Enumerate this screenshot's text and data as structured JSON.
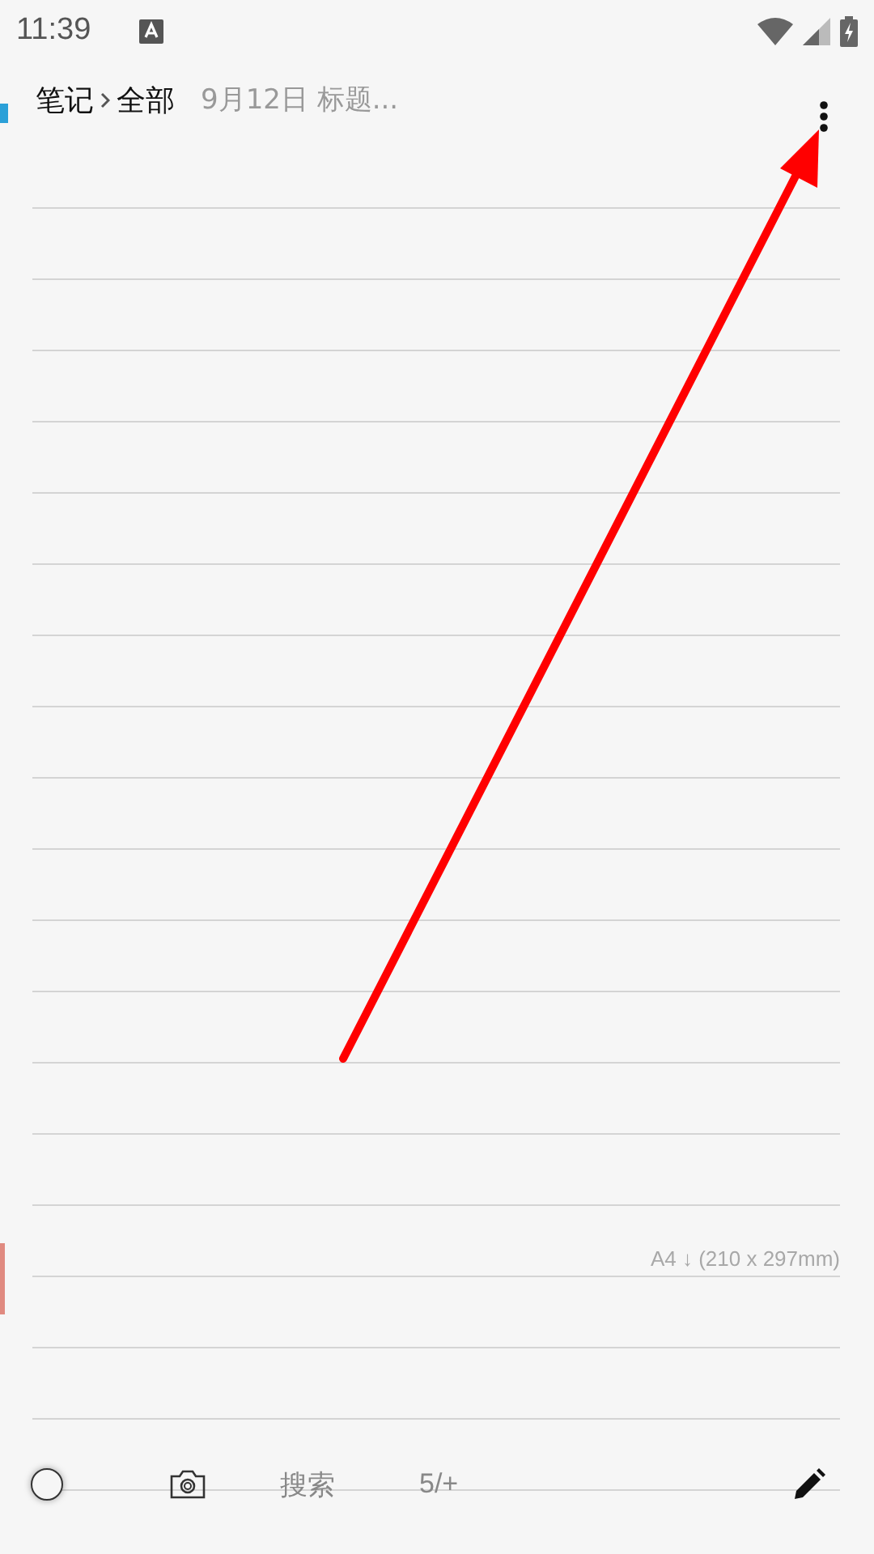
{
  "status_bar": {
    "time": "11:39"
  },
  "header": {
    "breadcrumb": [
      "笔记",
      "全部"
    ],
    "subtitle": "9月12日 标题..."
  },
  "page": {
    "size_label": "A4 ↓ (210 x 297mm)"
  },
  "toolbar": {
    "search": "搜索",
    "page_count": "5/+"
  }
}
